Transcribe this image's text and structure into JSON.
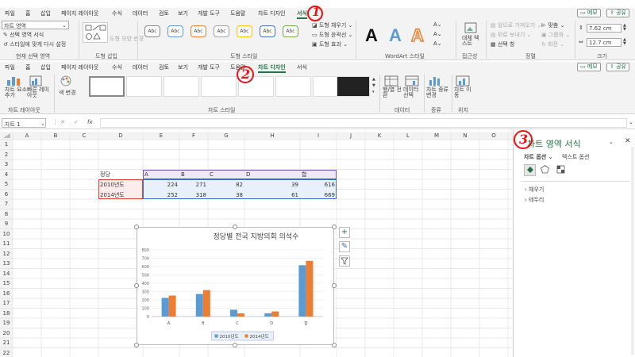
{
  "top_tabs": [
    "파일",
    "홈",
    "삽입",
    "페이지 레이아웃",
    "수식",
    "데이터",
    "검토",
    "보기",
    "개발 도구",
    "도움말",
    "차트 디자인",
    "서식"
  ],
  "top_active": "서식",
  "memo_label": "메모",
  "share_label": "공유",
  "format_ribbon": {
    "element_select": "차트 영역",
    "format_selection": "선택 영역 서식",
    "reset_style": "스타일에 맞게 다시 설정",
    "current_selection_label": "현재 선택 영역",
    "insert_shapes_label": "도형 삽입",
    "change_shape": "도형 모양 변경",
    "shape_style_sample": "Abc",
    "shape_styles_label": "도형 스타일",
    "shape_fill": "도형 채우기",
    "shape_outline": "도형 윤곽선",
    "shape_effects": "도형 효과",
    "wordart_letter": "A",
    "wordart_label": "WordArt 스타일",
    "alt_text": "대체 텍스트",
    "accessibility_label": "접근성",
    "bring_forward": "앞으로 가져오기",
    "send_backward": "뒤로 보내기",
    "selection_pane": "선택 창",
    "align": "맞춤",
    "group": "그룹화",
    "rotate": "회전",
    "arrange_label": "정렬",
    "height": "7.62 cm",
    "width": "12.7 cm",
    "size_label": "크기"
  },
  "design_tabs": [
    "파일",
    "홈",
    "삽입",
    "페이지 레이아웃",
    "수식",
    "데이터",
    "검토",
    "보기",
    "개발 도구",
    "도움말",
    "차트 디자인",
    "서식"
  ],
  "design_active": "차트 디자인",
  "design_ribbon": {
    "add_chart_element": "차트 요소 추가",
    "quick_layout": "빠른 레이아웃",
    "layouts_label": "차트 레이아웃",
    "change_colors": "색 변경",
    "styles_label": "차트 스타일",
    "switch_row_col": "행/열 전환",
    "select_data": "데이터 선택",
    "data_label": "데이터",
    "change_type": "차트 종류 변경",
    "type_label": "종류",
    "move_chart": "차트 이동",
    "location_label": "위치"
  },
  "name_box": "차트 1",
  "fx": "fx",
  "columns": [
    "A",
    "B",
    "C",
    "D",
    "E",
    "F",
    "G",
    "H",
    "I",
    "J",
    "K",
    "L",
    "M",
    "N",
    "O"
  ],
  "rows": [
    "1",
    "2",
    "3",
    "4",
    "5",
    "6",
    "7",
    "8",
    "9",
    "10",
    "11",
    "12",
    "13",
    "14",
    "15",
    "16",
    "17",
    "18",
    "19",
    "20",
    "21",
    "22"
  ],
  "table": {
    "header": [
      "정당",
      "A",
      "B",
      "C",
      "D",
      "합"
    ],
    "rows": [
      {
        "label": "2010년도",
        "values": [
          "224",
          "271",
          "82",
          "39",
          "616"
        ]
      },
      {
        "label": "2014년도",
        "values": [
          "252",
          "318",
          "38",
          "61",
          "669"
        ]
      }
    ]
  },
  "chart_data": {
    "type": "bar",
    "title": "정당별 전국 지방의회 의석수",
    "categories": [
      "A",
      "B",
      "C",
      "D",
      "합"
    ],
    "series": [
      {
        "name": "2010년도",
        "values": [
          224,
          271,
          82,
          39,
          616
        ],
        "color": "#5b9bd5"
      },
      {
        "name": "2014년도",
        "values": [
          252,
          318,
          38,
          61,
          669
        ],
        "color": "#ed7d31"
      }
    ],
    "ylim": [
      0,
      800
    ],
    "yticks": [
      "0",
      "100",
      "200",
      "300",
      "400",
      "500",
      "600",
      "700",
      "800"
    ],
    "grid": true,
    "legend": "bottom"
  },
  "pane": {
    "title": "차트 영역 서식",
    "tab_chart_options": "차트 옵션",
    "tab_text_options": "텍스트 옵션",
    "fill": "채우기",
    "border": "테두리"
  },
  "annotations": [
    "1",
    "2",
    "3"
  ]
}
